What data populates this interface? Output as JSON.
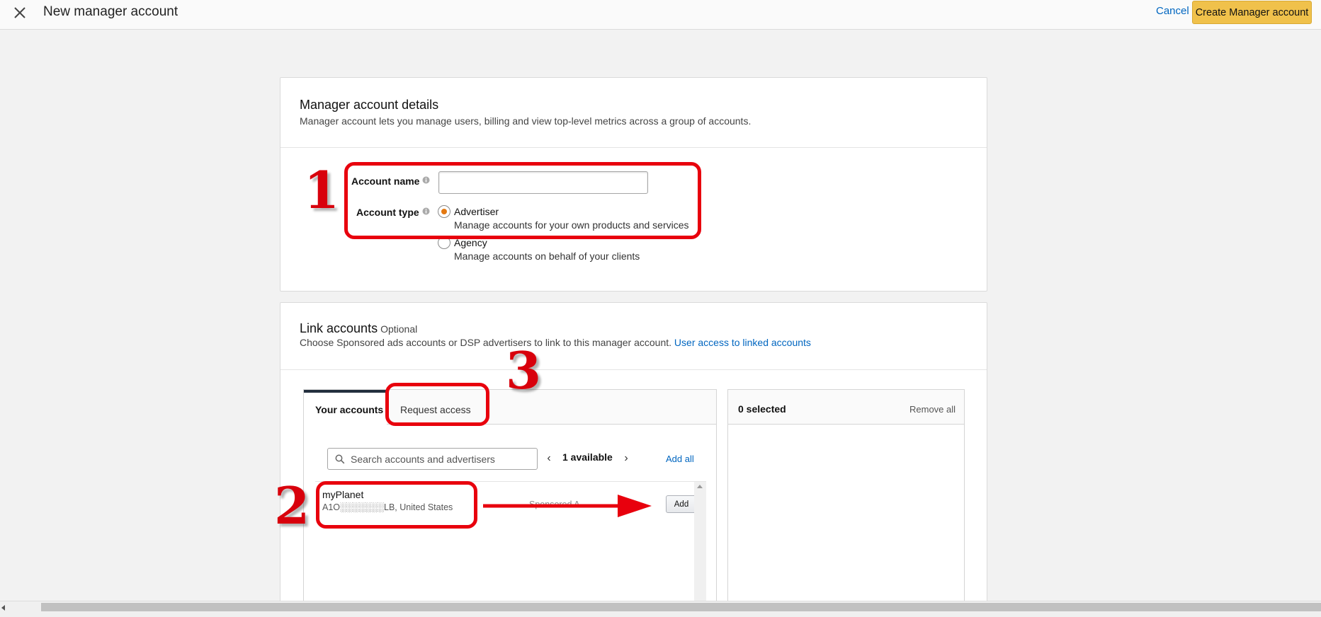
{
  "header": {
    "title": "New manager account",
    "cancel_label": "Cancel",
    "create_label": "Create Manager account"
  },
  "details": {
    "title": "Manager account details",
    "subtitle": "Manager account lets you manage users, billing and view top-level metrics across a group of accounts.",
    "account_name_label": "Account name",
    "account_name_value": "",
    "account_type_label": "Account type",
    "options": [
      {
        "label": "Advertiser",
        "description": "Manage accounts for your own products and services",
        "selected": true
      },
      {
        "label": "Agency",
        "description": "Manage accounts on behalf of your clients",
        "selected": false
      }
    ]
  },
  "link_accounts": {
    "title": "Link accounts",
    "optional": "Optional",
    "subtitle": "Choose Sponsored ads accounts or DSP advertisers to link to this manager account.",
    "subtitle_link": "User access to linked accounts",
    "tabs": [
      "Your accounts",
      "Request access"
    ],
    "search_placeholder": "Search accounts and advertisers",
    "available": "1 available",
    "add_all": "Add all",
    "accounts": [
      {
        "name": "myPlanet",
        "id": "A1O░░░░░░░LB, United States",
        "type": "Sponsored A",
        "add_label": "Add"
      }
    ],
    "selected_count": "0 selected",
    "remove_all": "Remove all"
  },
  "annotations": [
    "1",
    "2",
    "3"
  ],
  "colors": {
    "accent_button": "#f0c14b",
    "link": "#0066c0",
    "annotation": "#e8000d",
    "radio_selected": "#e47911"
  }
}
